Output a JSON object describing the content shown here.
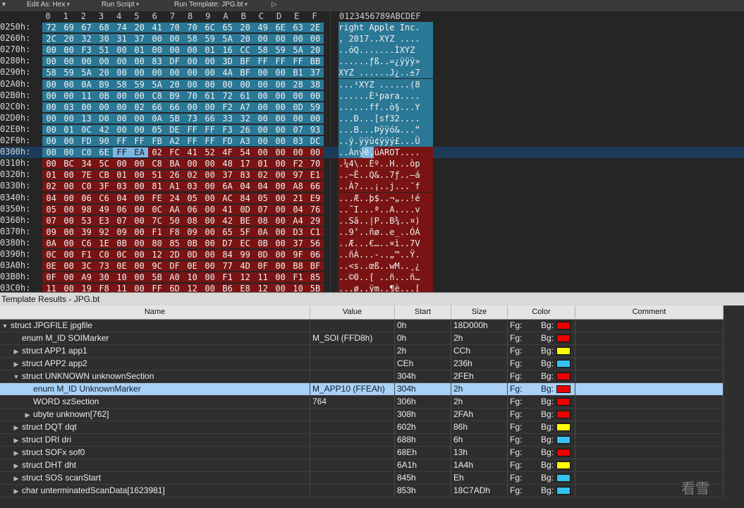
{
  "toolbar": {
    "edit_as": "Edit As: Hex",
    "run_script": "Run Script",
    "run_template": "Run Template: JPG.bt"
  },
  "hex": {
    "columns": [
      "0",
      "1",
      "2",
      "3",
      "4",
      "5",
      "6",
      "7",
      "8",
      "9",
      "A",
      "B",
      "C",
      "D",
      "E",
      "F"
    ],
    "ascii_header": "0123456789ABCDEF",
    "rows": [
      {
        "addr": "0250h:",
        "bytes": [
          "72",
          "69",
          "67",
          "68",
          "74",
          "20",
          "41",
          "70",
          "70",
          "6C",
          "65",
          "20",
          "49",
          "6E",
          "63",
          "2E"
        ],
        "ascii": "right Apple Inc."
      },
      {
        "addr": "0260h:",
        "bytes": [
          "2C",
          "20",
          "32",
          "30",
          "31",
          "37",
          "00",
          "00",
          "58",
          "59",
          "5A",
          "20",
          "00",
          "00",
          "00",
          "00"
        ],
        "ascii": ", 2017..XYZ ...."
      },
      {
        "addr": "0270h:",
        "bytes": [
          "00",
          "00",
          "F3",
          "51",
          "00",
          "01",
          "00",
          "00",
          "00",
          "01",
          "16",
          "CC",
          "58",
          "59",
          "5A",
          "20"
        ],
        "ascii": "..óQ.......ÌXYZ "
      },
      {
        "addr": "0280h:",
        "bytes": [
          "00",
          "00",
          "00",
          "00",
          "00",
          "00",
          "83",
          "DF",
          "00",
          "00",
          "3D",
          "BF",
          "FF",
          "FF",
          "FF",
          "BB"
        ],
        "ascii": "......ƒß..=¿ÿÿÿ»"
      },
      {
        "addr": "0290h:",
        "bytes": [
          "58",
          "59",
          "5A",
          "20",
          "00",
          "00",
          "00",
          "00",
          "00",
          "00",
          "4A",
          "BF",
          "00",
          "00",
          "B1",
          "37"
        ],
        "ascii": "XYZ ......J¿..±7"
      },
      {
        "addr": "02A0h:",
        "bytes": [
          "00",
          "00",
          "0A",
          "B9",
          "58",
          "59",
          "5A",
          "20",
          "00",
          "00",
          "00",
          "00",
          "00",
          "00",
          "28",
          "38"
        ],
        "ascii": "...¹XYZ ......(8"
      },
      {
        "addr": "02B0h:",
        "bytes": [
          "00",
          "00",
          "11",
          "0B",
          "00",
          "00",
          "C8",
          "B9",
          "70",
          "61",
          "72",
          "61",
          "00",
          "00",
          "00",
          "00"
        ],
        "ascii": "......È¹para...."
      },
      {
        "addr": "02C0h:",
        "bytes": [
          "00",
          "03",
          "00",
          "00",
          "00",
          "02",
          "66",
          "66",
          "00",
          "00",
          "F2",
          "A7",
          "00",
          "00",
          "0D",
          "59"
        ],
        "ascii": "......ff..ò§...Y"
      },
      {
        "addr": "02D0h:",
        "bytes": [
          "00",
          "00",
          "13",
          "D0",
          "00",
          "00",
          "0A",
          "5B",
          "73",
          "66",
          "33",
          "32",
          "00",
          "00",
          "00",
          "00"
        ],
        "ascii": "...Ð...[sf32...."
      },
      {
        "addr": "02E0h:",
        "bytes": [
          "00",
          "01",
          "0C",
          "42",
          "00",
          "00",
          "05",
          "DE",
          "FF",
          "FF",
          "F3",
          "26",
          "00",
          "00",
          "07",
          "93"
        ],
        "ascii": "...B...Þÿÿó&...“"
      },
      {
        "addr": "02F0h:",
        "bytes": [
          "00",
          "00",
          "FD",
          "90",
          "FF",
          "FF",
          "FB",
          "A2",
          "FF",
          "FF",
          "FD",
          "A3",
          "00",
          "00",
          "03",
          "DC"
        ],
        "ascii": "..ý.ÿÿû¢ÿÿý£...Ü"
      },
      {
        "addr": "0300h:",
        "bytes": [
          "00",
          "00",
          "C0",
          "6E",
          "FF",
          "EA",
          "02",
          "FC",
          "41",
          "52",
          "4F",
          "54",
          "00",
          "00",
          "00",
          "00"
        ],
        "ascii": "..Ànÿê.üAROT...."
      },
      {
        "addr": "0310h:",
        "bytes": [
          "00",
          "BC",
          "34",
          "5C",
          "00",
          "00",
          "C8",
          "BA",
          "00",
          "00",
          "48",
          "17",
          "01",
          "00",
          "F2",
          "70"
        ],
        "ascii": ".¼4\\..Èº..H...òp"
      },
      {
        "addr": "0320h:",
        "bytes": [
          "01",
          "00",
          "7E",
          "CB",
          "01",
          "00",
          "51",
          "26",
          "02",
          "00",
          "37",
          "83",
          "02",
          "00",
          "97",
          "E1"
        ],
        "ascii": "..~Ë..Q&..7ƒ..—á"
      },
      {
        "addr": "0330h:",
        "bytes": [
          "02",
          "00",
          "C0",
          "3F",
          "03",
          "00",
          "81",
          "A1",
          "03",
          "00",
          "6A",
          "04",
          "04",
          "00",
          "A8",
          "66"
        ],
        "ascii": "..À?...¡..j...¨f"
      },
      {
        "addr": "0340h:",
        "bytes": [
          "04",
          "00",
          "06",
          "C6",
          "04",
          "00",
          "FE",
          "24",
          "05",
          "00",
          "AC",
          "84",
          "05",
          "00",
          "21",
          "E9"
        ],
        "ascii": "...Æ..þ$..¬„..!é"
      },
      {
        "addr": "0350h:",
        "bytes": [
          "05",
          "00",
          "98",
          "49",
          "06",
          "00",
          "0C",
          "AA",
          "06",
          "00",
          "41",
          "0D",
          "07",
          "00",
          "04",
          "76"
        ],
        "ascii": "..˜I...ª..A....v"
      },
      {
        "addr": "0360h:",
        "bytes": [
          "07",
          "00",
          "53",
          "E3",
          "07",
          "00",
          "7C",
          "50",
          "08",
          "00",
          "42",
          "BE",
          "08",
          "00",
          "A4",
          "29"
        ],
        "ascii": "..Sã..|P..B¾..¤)"
      },
      {
        "addr": "0370h:",
        "bytes": [
          "09",
          "00",
          "39",
          "92",
          "09",
          "00",
          "F1",
          "F8",
          "09",
          "00",
          "65",
          "5F",
          "0A",
          "00",
          "D3",
          "C1"
        ],
        "ascii": "..9’..ñø..e_..ÓÁ"
      },
      {
        "addr": "0380h:",
        "bytes": [
          "0A",
          "00",
          "C6",
          "1E",
          "0B",
          "00",
          "80",
          "85",
          "0B",
          "00",
          "D7",
          "EC",
          "0B",
          "00",
          "37",
          "56"
        ],
        "ascii": "..Æ...€…..×ì..7V"
      },
      {
        "addr": "0390h:",
        "bytes": [
          "0C",
          "00",
          "F1",
          "C0",
          "0C",
          "00",
          "12",
          "2D",
          "0D",
          "00",
          "84",
          "99",
          "0D",
          "00",
          "9F",
          "06"
        ],
        "ascii": "..ñÀ...-..„™..Ÿ."
      },
      {
        "addr": "03A0h:",
        "bytes": [
          "0E",
          "00",
          "3C",
          "73",
          "0E",
          "00",
          "9C",
          "DF",
          "0E",
          "00",
          "77",
          "4D",
          "0F",
          "00",
          "B8",
          "BF"
        ],
        "ascii": "..<s..œß..wM..¸¿"
      },
      {
        "addr": "03B0h:",
        "bytes": [
          "0F",
          "00",
          "A9",
          "30",
          "10",
          "00",
          "5B",
          "A0",
          "10",
          "00",
          "F1",
          "12",
          "11",
          "00",
          "F1",
          "85"
        ],
        "ascii": "..©0..[ ..ñ...ñ…"
      },
      {
        "addr": "03C0h:",
        "bytes": [
          "11",
          "00",
          "19",
          "F8",
          "11",
          "00",
          "FF",
          "6D",
          "12",
          "00",
          "B6",
          "E8",
          "12",
          "00",
          "10",
          "5B"
        ],
        "ascii": "...ø..ÿm..¶è...["
      }
    ]
  },
  "results": {
    "title": "Template Results - JPG.bt",
    "columns": {
      "name": "Name",
      "value": "Value",
      "start": "Start",
      "size": "Size",
      "color": "Color",
      "comment": "Comment"
    },
    "fg_label": "Fg:",
    "bg_label": "Bg:",
    "colors": {
      "red": "#ee0000",
      "yellow": "#ffff00",
      "cyan": "#33c3f0"
    },
    "rows": [
      {
        "name": "struct JPGFILE jpgfile",
        "value": "",
        "start": "0h",
        "size": "18D000h",
        "bg": "#ee0000",
        "depth": 0,
        "toggle": "open"
      },
      {
        "name": "enum M_ID SOIMarker",
        "value": "M_SOI (FFD8h)",
        "start": "0h",
        "size": "2h",
        "bg": "#ee0000",
        "depth": 1,
        "toggle": "none"
      },
      {
        "name": "struct APP1 app1",
        "value": "",
        "start": "2h",
        "size": "CCh",
        "bg": "#ffff00",
        "depth": 1,
        "toggle": "closed"
      },
      {
        "name": "struct APP2 app2",
        "value": "",
        "start": "CEh",
        "size": "236h",
        "bg": "#33c3f0",
        "depth": 1,
        "toggle": "closed"
      },
      {
        "name": "struct UNKNOWN unknownSection",
        "value": "",
        "start": "304h",
        "size": "2FEh",
        "bg": "#ee0000",
        "depth": 1,
        "toggle": "open"
      },
      {
        "name": "enum M_ID UnknownMarker",
        "value": "M_APP10 (FFEAh)",
        "start": "304h",
        "size": "2h",
        "bg": "#ee0000",
        "depth": 2,
        "toggle": "none",
        "selected": true
      },
      {
        "name": "WORD szSection",
        "value": "764",
        "start": "306h",
        "size": "2h",
        "bg": "#ee0000",
        "depth": 2,
        "toggle": "none"
      },
      {
        "name": "ubyte unknown[762]",
        "value": "",
        "start": "308h",
        "size": "2FAh",
        "bg": "#ee0000",
        "depth": 2,
        "toggle": "closed"
      },
      {
        "name": "struct DQT dqt",
        "value": "",
        "start": "602h",
        "size": "86h",
        "bg": "#ffff00",
        "depth": 1,
        "toggle": "closed"
      },
      {
        "name": "struct DRI dri",
        "value": "",
        "start": "688h",
        "size": "6h",
        "bg": "#33c3f0",
        "depth": 1,
        "toggle": "closed"
      },
      {
        "name": "struct SOFx sof0",
        "value": "",
        "start": "68Eh",
        "size": "13h",
        "bg": "#ee0000",
        "depth": 1,
        "toggle": "closed"
      },
      {
        "name": "struct DHT dht",
        "value": "",
        "start": "6A1h",
        "size": "1A4h",
        "bg": "#ffff00",
        "depth": 1,
        "toggle": "closed"
      },
      {
        "name": "struct SOS scanStart",
        "value": "",
        "start": "845h",
        "size": "Eh",
        "bg": "#33c3f0",
        "depth": 1,
        "toggle": "closed"
      },
      {
        "name": "char unterminatedScanData[1623981]",
        "value": "",
        "start": "853h",
        "size": "18C7ADh",
        "bg": "#33c3f0",
        "depth": 1,
        "toggle": "closed"
      }
    ]
  },
  "watermark": "看雪"
}
